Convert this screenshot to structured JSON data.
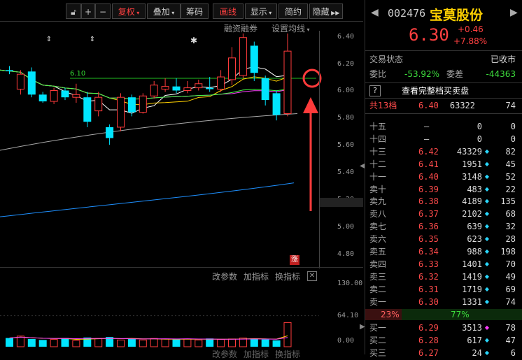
{
  "toolbar": {
    "buttons": [
      "复权",
      "叠加",
      "筹码",
      "画线",
      "显示",
      "简约",
      "隐藏"
    ]
  },
  "chart": {
    "links": [
      "融资融券",
      "设置均线"
    ],
    "price_labels": [
      "6.40",
      "6.20",
      "6.00",
      "5.80",
      "5.60",
      "5.40",
      "5.20",
      "5.00",
      "4.80"
    ],
    "level_label": "6.10",
    "limit_badge": "涨",
    "indicator_links": [
      "改参数",
      "加指标",
      "换指标"
    ],
    "vol_labels": [
      "130.00",
      "64.10",
      "0.00"
    ],
    "bottom_links": [
      "改参数",
      "加指标",
      "换指标"
    ]
  },
  "chart_data": {
    "type": "candlestick",
    "ylim": [
      4.7,
      6.45
    ],
    "candles": [
      {
        "o": 6.16,
        "c": 6.16,
        "h": 6.19,
        "l": 6.13,
        "up": false
      },
      {
        "o": 6.02,
        "c": 6.13,
        "h": 6.16,
        "l": 5.98,
        "up": true
      },
      {
        "o": 6.15,
        "c": 5.98,
        "h": 6.18,
        "l": 5.96,
        "up": false
      },
      {
        "o": 5.98,
        "c": 5.93,
        "h": 6.0,
        "l": 5.92,
        "up": false
      },
      {
        "o": 5.93,
        "c": 6.01,
        "h": 6.03,
        "l": 5.91,
        "up": true
      },
      {
        "o": 6.01,
        "c": 5.96,
        "h": 6.03,
        "l": 5.94,
        "up": false
      },
      {
        "o": 5.96,
        "c": 5.98,
        "h": 6.06,
        "l": 5.92,
        "up": true
      },
      {
        "o": 5.96,
        "c": 5.78,
        "h": 6.0,
        "l": 5.74,
        "up": false
      },
      {
        "o": 5.86,
        "c": 5.96,
        "h": 6.0,
        "l": 5.82,
        "up": true
      },
      {
        "o": 5.74,
        "c": 5.66,
        "h": 5.76,
        "l": 5.61,
        "up": false
      },
      {
        "o": 5.74,
        "c": 5.96,
        "h": 5.99,
        "l": 5.71,
        "up": true
      },
      {
        "o": 5.96,
        "c": 5.85,
        "h": 5.98,
        "l": 5.82,
        "up": false
      },
      {
        "o": 5.85,
        "c": 5.97,
        "h": 5.99,
        "l": 5.84,
        "up": true
      },
      {
        "o": 5.97,
        "c": 6.05,
        "h": 6.08,
        "l": 5.95,
        "up": true
      },
      {
        "o": 6.02,
        "c": 6.04,
        "h": 6.1,
        "l": 6.0,
        "up": true
      },
      {
        "o": 6.04,
        "c": 6.01,
        "h": 6.1,
        "l": 5.99,
        "up": false
      },
      {
        "o": 6.01,
        "c": 6.03,
        "h": 6.08,
        "l": 5.99,
        "up": true
      },
      {
        "o": 6.03,
        "c": 6.06,
        "h": 6.09,
        "l": 6.01,
        "up": true
      },
      {
        "o": 6.03,
        "c": 6.02,
        "h": 6.11,
        "l": 6.0,
        "up": false
      },
      {
        "o": 6.02,
        "c": 6.11,
        "h": 6.16,
        "l": 6.0,
        "up": true
      },
      {
        "o": 6.09,
        "c": 6.25,
        "h": 6.33,
        "l": 6.05,
        "up": true
      },
      {
        "o": 6.12,
        "c": 6.4,
        "h": 6.43,
        "l": 6.1,
        "up": true
      },
      {
        "o": 6.34,
        "c": 6.14,
        "h": 6.37,
        "l": 6.08,
        "up": false
      },
      {
        "o": 6.1,
        "c": 5.94,
        "h": 6.12,
        "l": 5.9,
        "up": false
      },
      {
        "o": 5.99,
        "c": 5.83,
        "h": 6.01,
        "l": 5.79,
        "up": false
      },
      {
        "o": 5.84,
        "c": 6.3,
        "h": 6.43,
        "l": 5.82,
        "up": true
      }
    ],
    "volumes": [
      18,
      22,
      16,
      14,
      15,
      18,
      13,
      19,
      17,
      20,
      14,
      16,
      14,
      17,
      16,
      15,
      16,
      14,
      17,
      15,
      16,
      18,
      17,
      15,
      13,
      50
    ]
  },
  "stock": {
    "code": "002476",
    "name": "宝莫股份",
    "price": "6.30",
    "change": "+0.46",
    "change_pct": "+7.88%",
    "status_label": "交易状态",
    "status_value": "已收市",
    "weibi_label": "委比",
    "weibi_value": "-53.92%",
    "weicha_label": "委差",
    "weicha_value": "-44363",
    "help": "?",
    "full_book": "查看完整档买卖盘",
    "total_label": "共13档",
    "total_price": "6.40",
    "total_vol": "63322",
    "total_chg": "74"
  },
  "asks": [
    {
      "label": "十五",
      "price": "—",
      "vol": "0",
      "chg": "0"
    },
    {
      "label": "十四",
      "price": "—",
      "vol": "0",
      "chg": "0"
    },
    {
      "label": "十三",
      "price": "6.42",
      "vol": "43329",
      "chg": "82"
    },
    {
      "label": "十二",
      "price": "6.41",
      "vol": "1951",
      "chg": "45"
    },
    {
      "label": "十一",
      "price": "6.40",
      "vol": "3148",
      "chg": "52"
    },
    {
      "label": "卖十",
      "price": "6.39",
      "vol": "483",
      "chg": "22"
    },
    {
      "label": "卖九",
      "price": "6.38",
      "vol": "4189",
      "chg": "135"
    },
    {
      "label": "卖八",
      "price": "6.37",
      "vol": "2102",
      "chg": "68"
    },
    {
      "label": "卖七",
      "price": "6.36",
      "vol": "639",
      "chg": "32"
    },
    {
      "label": "卖六",
      "price": "6.35",
      "vol": "623",
      "chg": "28"
    },
    {
      "label": "卖五",
      "price": "6.34",
      "vol": "988",
      "chg": "198"
    },
    {
      "label": "卖四",
      "price": "6.33",
      "vol": "1401",
      "chg": "70"
    },
    {
      "label": "卖三",
      "price": "6.32",
      "vol": "1419",
      "chg": "49"
    },
    {
      "label": "卖二",
      "price": "6.31",
      "vol": "1719",
      "chg": "69"
    },
    {
      "label": "卖一",
      "price": "6.30",
      "vol": "1331",
      "chg": "74"
    }
  ],
  "ratio": {
    "left": "23%",
    "right": "77%",
    "left_fraction": 0.23
  },
  "bids": [
    {
      "label": "买一",
      "price": "6.29",
      "vol": "3513",
      "chg": "78",
      "magenta": true
    },
    {
      "label": "买二",
      "price": "6.28",
      "vol": "617",
      "chg": "47",
      "magenta": false
    },
    {
      "label": "买三",
      "price": "6.27",
      "vol": "24",
      "chg": "6",
      "magenta": false
    }
  ],
  "colors": {
    "up": "#ff3b3b",
    "down": "#00e5ff",
    "ma5": "#ffffff",
    "ma10": "#ffd000",
    "ma20": "#ff40ff",
    "ma30": "#40ff40",
    "ma60": "#aaaaaa",
    "ma120": "#1e90ff",
    "arrow": "#ff3b3b"
  }
}
